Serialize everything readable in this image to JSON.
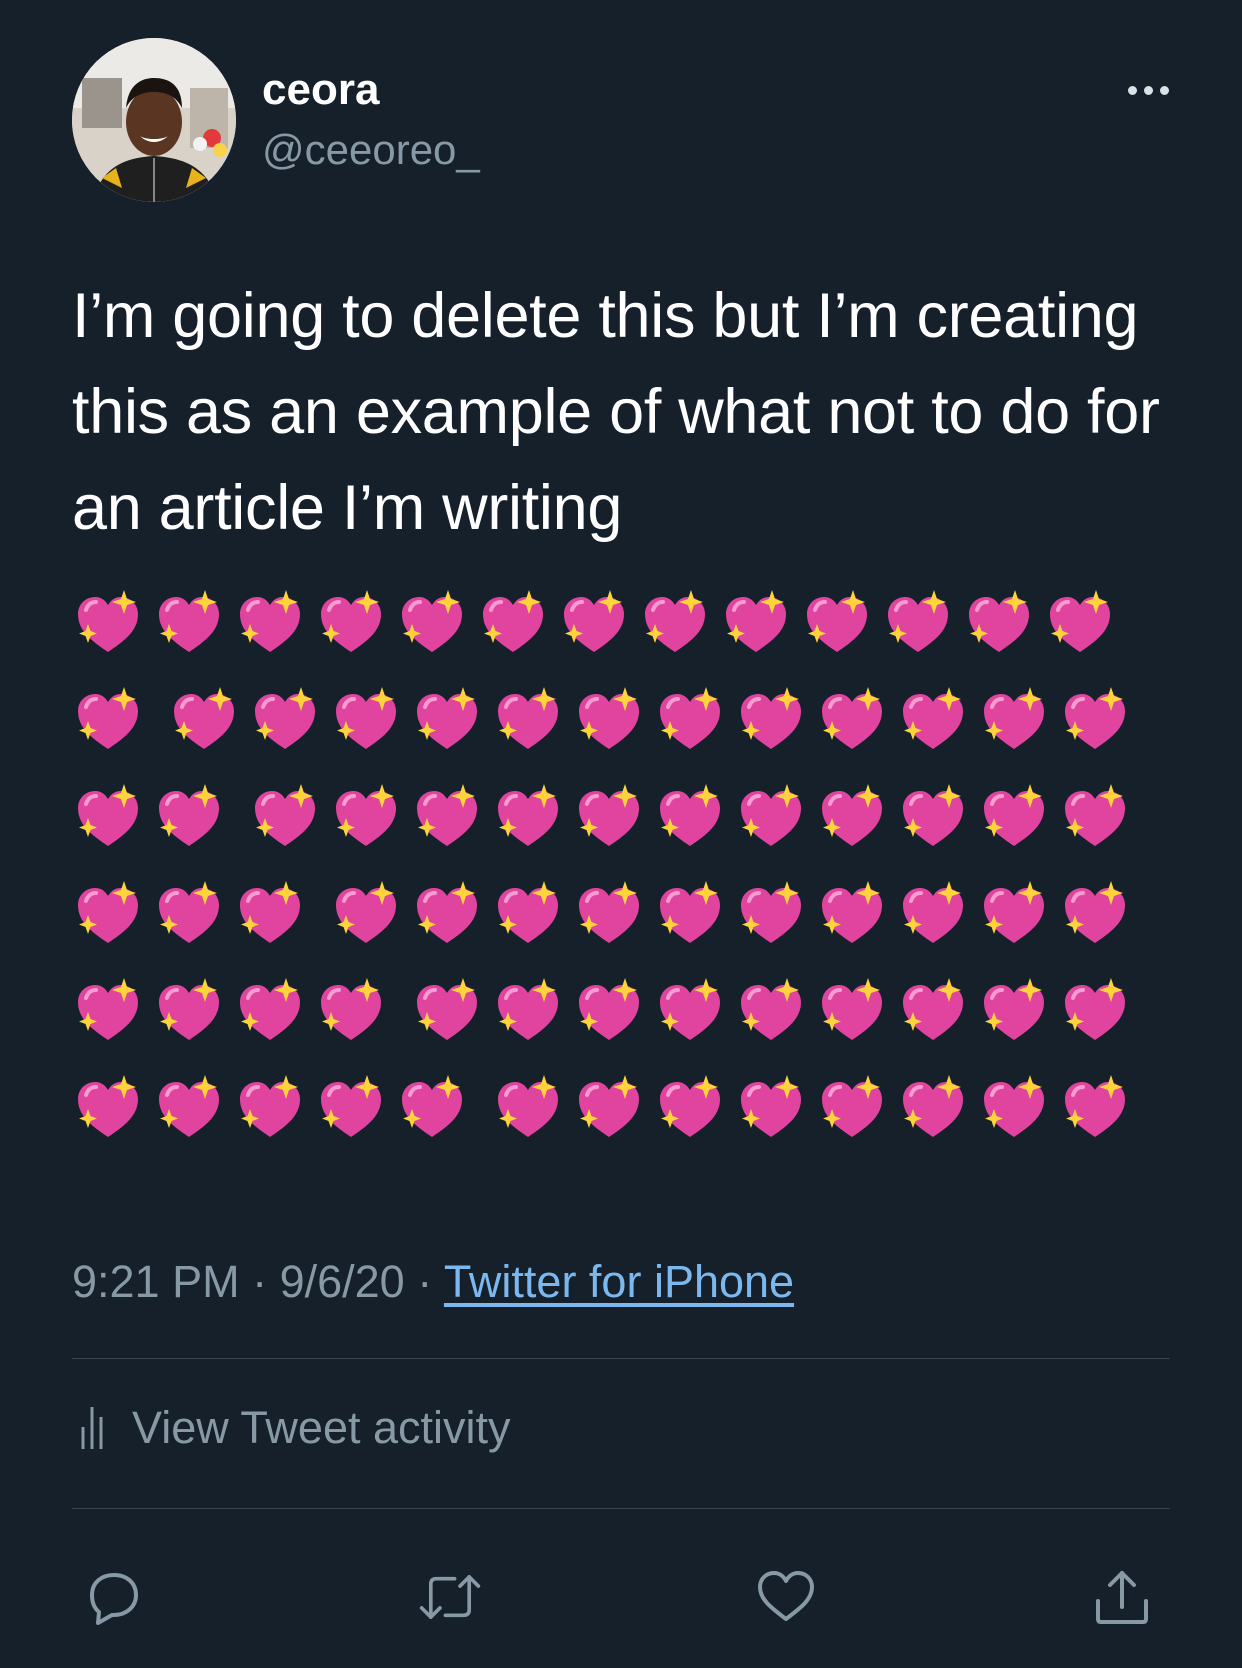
{
  "user": {
    "display_name": "ceora",
    "handle": "@ceeoreo_"
  },
  "tweet": {
    "text": "I’m going to delete this but I’m creating this as an example of what not to do for an article I’m writing",
    "emoji": "sparkling-heart",
    "emoji_rows": [
      13,
      13,
      13,
      13,
      13,
      13
    ],
    "time": "9:21 PM",
    "date": "9/6/20",
    "separator": " · ",
    "source": "Twitter for iPhone"
  },
  "activity": {
    "label": "View Tweet activity"
  },
  "actions": [
    "reply-icon",
    "retweet-icon",
    "like-icon",
    "share-icon"
  ],
  "colors": {
    "background": "#15202b",
    "secondary_text": "#8899a6",
    "link": "#7bb8f0",
    "divider": "#38444d",
    "heart_pink": "#e0449e",
    "sparkle_yellow": "#ffd43b"
  }
}
